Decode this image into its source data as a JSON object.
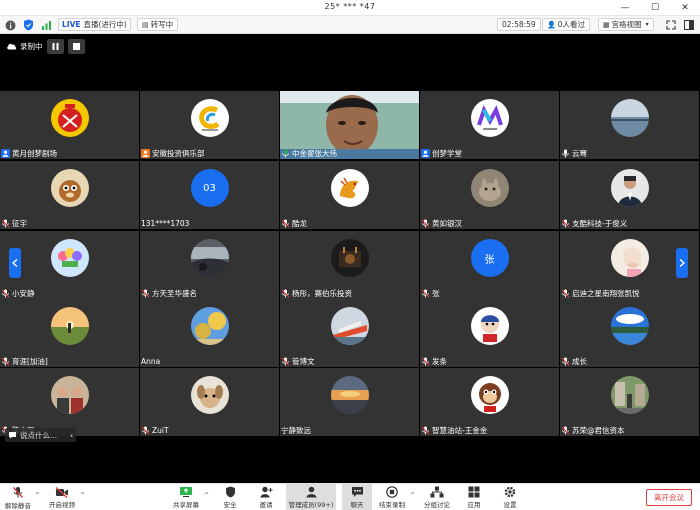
{
  "window": {
    "title": "25* *** *47"
  },
  "infobar": {
    "live_badge": "LIVE",
    "live_label": "直播(进行中)",
    "transcribe_label": "转写中",
    "timer": "02:58:59",
    "watchers_label": "0人看过",
    "view_label": "宫格视图"
  },
  "recording": {
    "label": "录制中"
  },
  "participants": [
    {
      "name": "黄月创梦剧场",
      "avatar": "red-badge-logo",
      "badge": "user-blue-icon"
    },
    {
      "name": "安徽投资俱乐部",
      "avatar": "c-brand-logo",
      "badge": "user-orange-icon"
    },
    {
      "name": "中金翟张大伟",
      "avatar": "video-face",
      "badge": "mic-green-icon"
    },
    {
      "name": "创梦学堂",
      "avatar": "m-brand-logo",
      "badge": "user-blue-icon"
    },
    {
      "name": "云骞",
      "avatar": "sea-photo",
      "badge": "mic-icon"
    },
    {
      "name": "征宇",
      "avatar": "cartoon-squirrel",
      "badge": "mic-muted-icon"
    },
    {
      "name": "131****1703",
      "avatar": "03",
      "badge": ""
    },
    {
      "name": "酷龙",
      "avatar": "dragon-illustration",
      "badge": "mic-muted-icon"
    },
    {
      "name": "黄如银汉",
      "avatar": "cat-photo",
      "badge": "mic-muted-icon"
    },
    {
      "name": "支酷科技-于俊义",
      "avatar": "portrait-man",
      "badge": "mic-muted-icon"
    },
    {
      "name": "小安静",
      "avatar": "tulips-cartoon",
      "badge": "mic-muted-icon"
    },
    {
      "name": "方天圣华盛名",
      "avatar": "car-interior",
      "badge": "mic-muted-icon"
    },
    {
      "name": "杨彤，赛伯乐投资",
      "avatar": "dark-scene",
      "badge": "mic-muted-icon"
    },
    {
      "name": "张",
      "avatar": "张",
      "badge": "mic-muted-icon"
    },
    {
      "name": "启迪之星南翔张凯悦",
      "avatar": "pink-portrait",
      "badge": "mic-muted-icon"
    },
    {
      "name": "育涯[加油]",
      "avatar": "sunset-field",
      "badge": "mic-muted-icon"
    },
    {
      "name": "Anna",
      "avatar": "blue-sky-tree",
      "badge": ""
    },
    {
      "name": "管博文",
      "avatar": "ship-photo",
      "badge": "mic-muted-icon"
    },
    {
      "name": "发条",
      "avatar": "cartoon-character",
      "badge": "mic-muted-icon"
    },
    {
      "name": "成长",
      "avatar": "lake-sky",
      "badge": "mic-muted-icon"
    },
    {
      "name": "陈志强",
      "avatar": "group-photo",
      "badge": "mic-muted-icon"
    },
    {
      "name": "ZuiT",
      "avatar": "dog-photo",
      "badge": "mic-muted-icon"
    },
    {
      "name": "宁静致远",
      "avatar": "sunset-clouds",
      "badge": ""
    },
    {
      "name": "智慧油站-王金金",
      "avatar": "monkey-cartoon",
      "badge": "mic-muted-icon"
    },
    {
      "name": "苏荣@君信资本",
      "avatar": "street-photo",
      "badge": "mic-muted-icon"
    }
  ],
  "chat": {
    "preview": "说点什么..."
  },
  "toolbar": {
    "unmute": "解除静音",
    "start_video": "开启视频",
    "share_screen": "共享屏幕",
    "security": "安全",
    "invite": "邀请",
    "manage_members": "管理成员(99+)",
    "chat": "聊天",
    "end_record": "结束录制",
    "breakout": "分组讨论",
    "apps": "应用",
    "settings": "设置",
    "leave": "离开会议"
  },
  "colors": {
    "accent": "#1a6ff0",
    "tile_bg": "#333333",
    "leave_red": "#e04040",
    "muted_red": "#e03a3a"
  }
}
